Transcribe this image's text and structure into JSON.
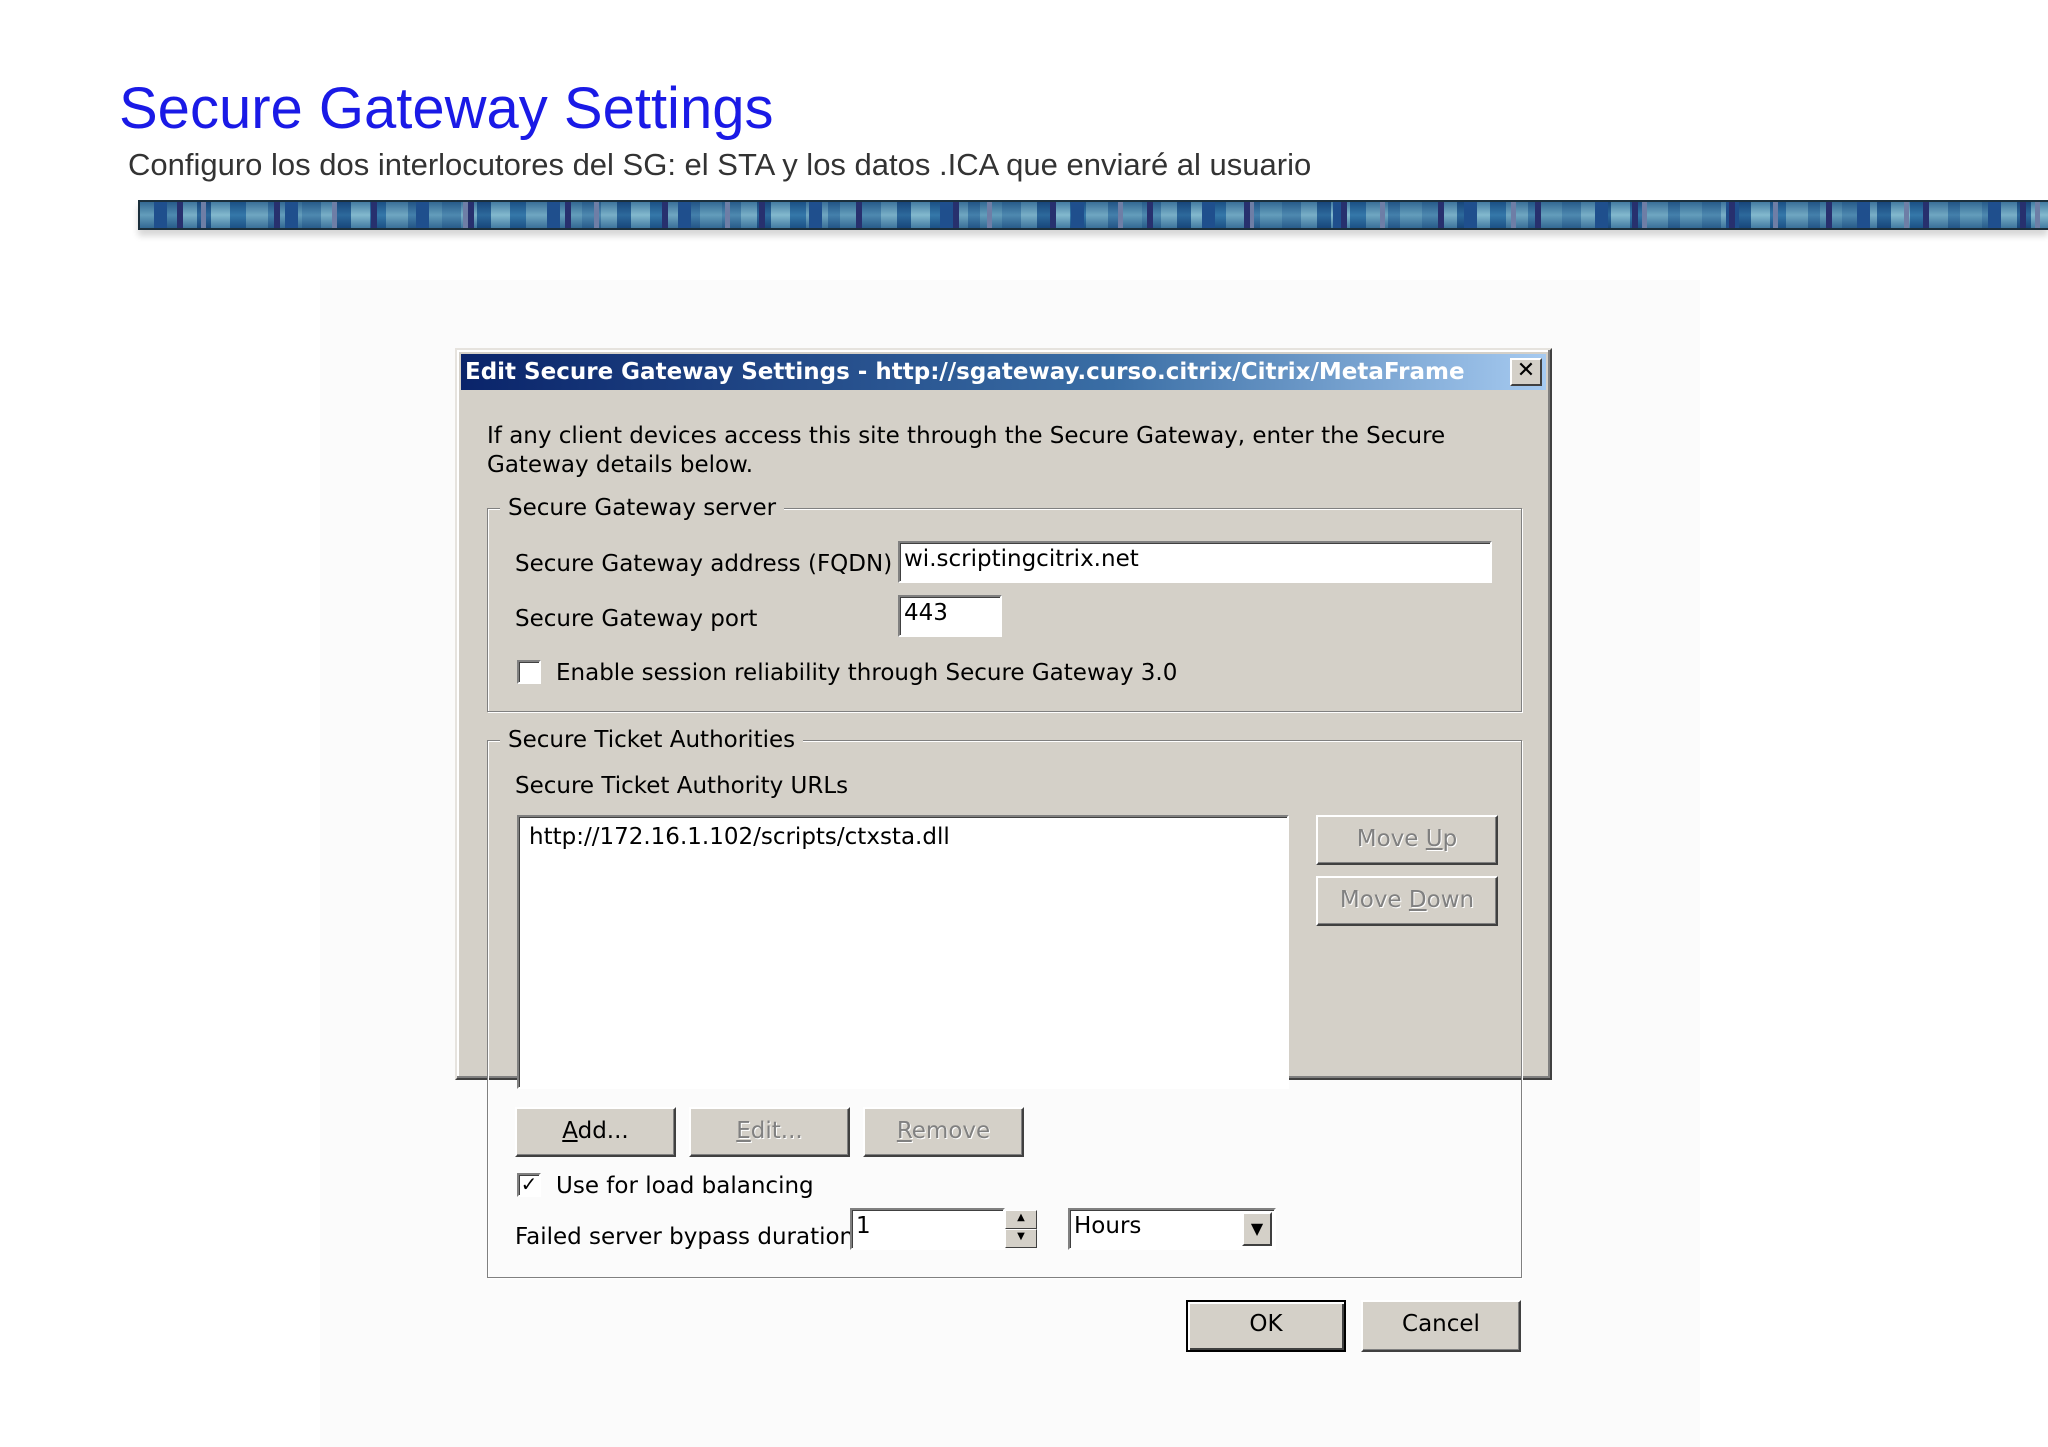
{
  "slide": {
    "title": "Secure Gateway Settings",
    "subtitle": "Configuro los dos interlocutores del SG: el STA y los datos .ICA que enviaré al usuario"
  },
  "dialog": {
    "title": "Edit Secure Gateway Settings - http://sgateway.curso.citrix/Citrix/MetaFrame",
    "close_icon": "close-icon",
    "intro": "If any client devices access this site through the Secure Gateway, enter the Secure Gateway details below.",
    "server_group": {
      "legend": "Secure Gateway server",
      "address_label": "Secure Gateway address (FQDN)",
      "address_value": "wi.scriptingcitrix.net",
      "port_label": "Secure Gateway port",
      "port_value": "443",
      "reliability_label": "Enable session reliability through Secure Gateway 3.0",
      "reliability_checked": false
    },
    "sta_group": {
      "legend": "Secure Ticket Authorities",
      "urls_label": "Secure Ticket Authority URLs",
      "urls": [
        "http://172.16.1.102/scripts/ctxsta.dll"
      ],
      "move_up": "Move Up",
      "move_down": "Move Down",
      "add": "Add...",
      "edit": "Edit...",
      "remove": "Remove",
      "load_balancing_label": "Use for load balancing",
      "load_balancing_checked": true,
      "bypass_label": "Failed server bypass duration",
      "bypass_value": "1",
      "bypass_unit": "Hours"
    },
    "ok": "OK",
    "cancel": "Cancel"
  }
}
